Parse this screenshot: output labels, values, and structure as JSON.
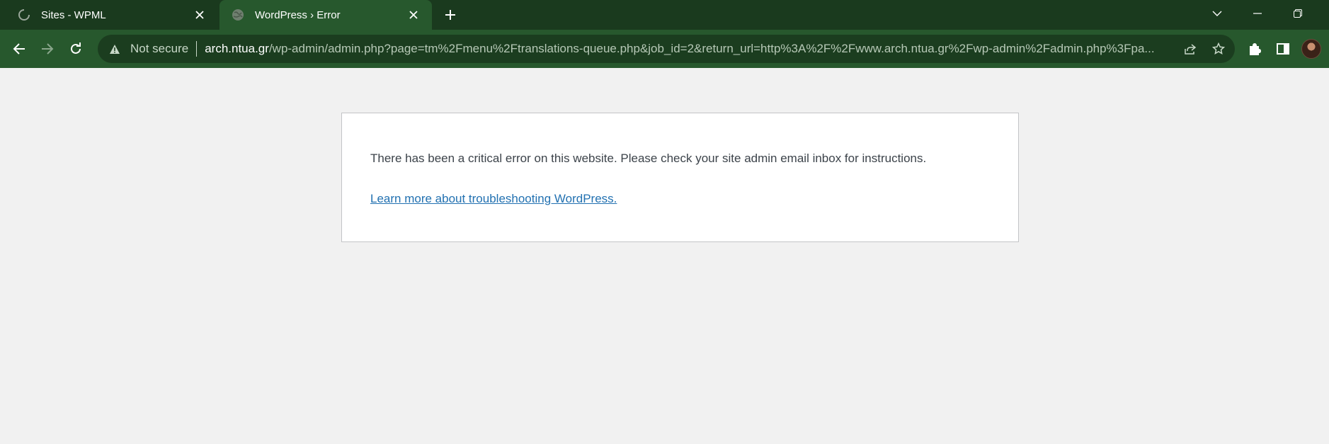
{
  "tabs": [
    {
      "title": "Sites - WPML",
      "favicon": "wpml-logo-icon",
      "active": false
    },
    {
      "title": "WordPress › Error",
      "favicon": "globe-icon",
      "active": true
    }
  ],
  "address_bar": {
    "security_label": "Not secure",
    "url_host": "arch.ntua.gr",
    "url_path": "/wp-admin/admin.php?page=tm%2Fmenu%2Ftranslations-queue.php&job_id=2&return_url=http%3A%2F%2Fwww.arch.ntua.gr%2Fwp-admin%2Fadmin.php%3Fpa..."
  },
  "error": {
    "message": "There has been a critical error on this website. Please check your site admin email inbox for instructions.",
    "link_text": "Learn more about troubleshooting WordPress."
  },
  "colors": {
    "tabstrip": "#1a3a1e",
    "toolbar": "#27582d",
    "link": "#2271b1"
  }
}
